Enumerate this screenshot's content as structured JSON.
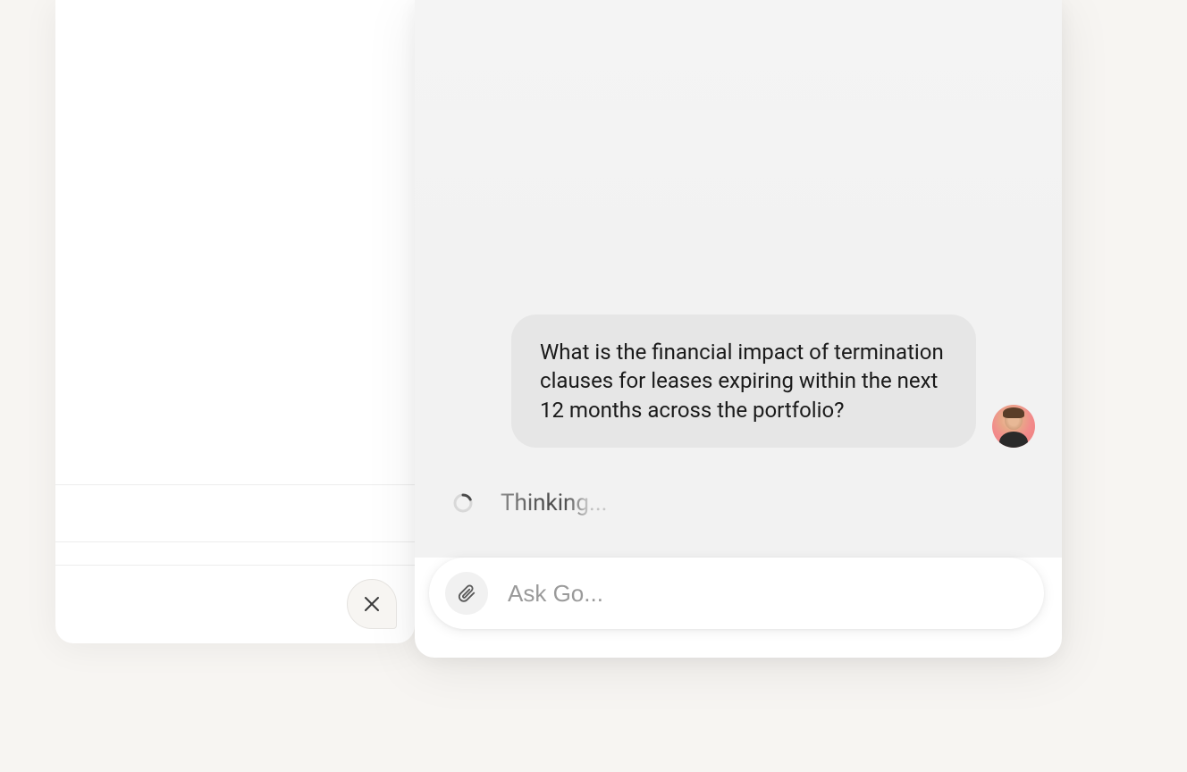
{
  "chat": {
    "user_message": "What is the financial impact of termination clauses for leases expiring within the next 12 months across the portfolio?",
    "status_text": "Thinking..."
  },
  "input": {
    "placeholder": "Ask Go..."
  },
  "icons": {
    "close": "close-icon",
    "attach": "paperclip-icon",
    "spinner": "spinner-icon",
    "avatar": "user-avatar"
  }
}
